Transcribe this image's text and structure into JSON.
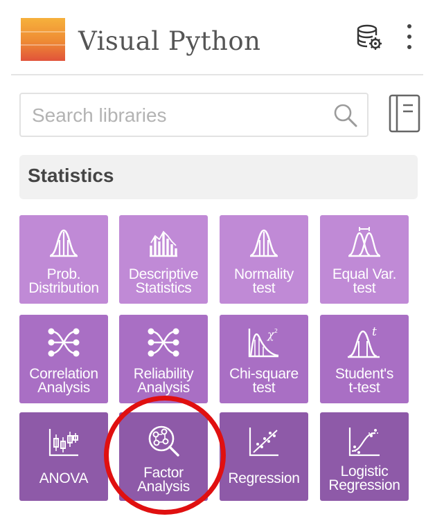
{
  "app": {
    "title": "Visual Python"
  },
  "search": {
    "placeholder": "Search libraries",
    "value": ""
  },
  "section": {
    "title": "Statistics"
  },
  "tiles": [
    {
      "label": "Prob.\nDistribution",
      "icon": "bell-curve-icon",
      "color": "#c08ad6"
    },
    {
      "label": "Descriptive\nStatistics",
      "icon": "histogram-icon",
      "color": "#c08ad6"
    },
    {
      "label": "Normality\ntest",
      "icon": "bell-curve-icon",
      "color": "#c08ad6"
    },
    {
      "label": "Equal Var.\ntest",
      "icon": "overlapping-curves-icon",
      "color": "#c08ad6"
    },
    {
      "label": "Correlation\nAnalysis",
      "icon": "network-icon",
      "color": "#a96fc4"
    },
    {
      "label": "Reliability\nAnalysis",
      "icon": "network-icon",
      "color": "#a96fc4"
    },
    {
      "label": "Chi-square\ntest",
      "icon": "chi-square-distribution-icon",
      "color": "#a96fc4"
    },
    {
      "label": "Student's\nt-test",
      "icon": "t-distribution-icon",
      "color": "#a96fc4"
    },
    {
      "label": "ANOVA",
      "icon": "candlestick-icon",
      "color": "#8e5aa8"
    },
    {
      "label": "Factor\nAnalysis",
      "icon": "factor-search-icon",
      "color": "#8e5aa8"
    },
    {
      "label": "Regression",
      "icon": "scatter-trend-icon",
      "color": "#8e5aa8"
    },
    {
      "label": "Logistic\nRegression",
      "icon": "logistic-curve-icon",
      "color": "#8e5aa8"
    }
  ],
  "colors": {
    "highlight_circle": "#e01010",
    "logo_top": "#f6b13c",
    "logo_bottom": "#e1533a"
  }
}
